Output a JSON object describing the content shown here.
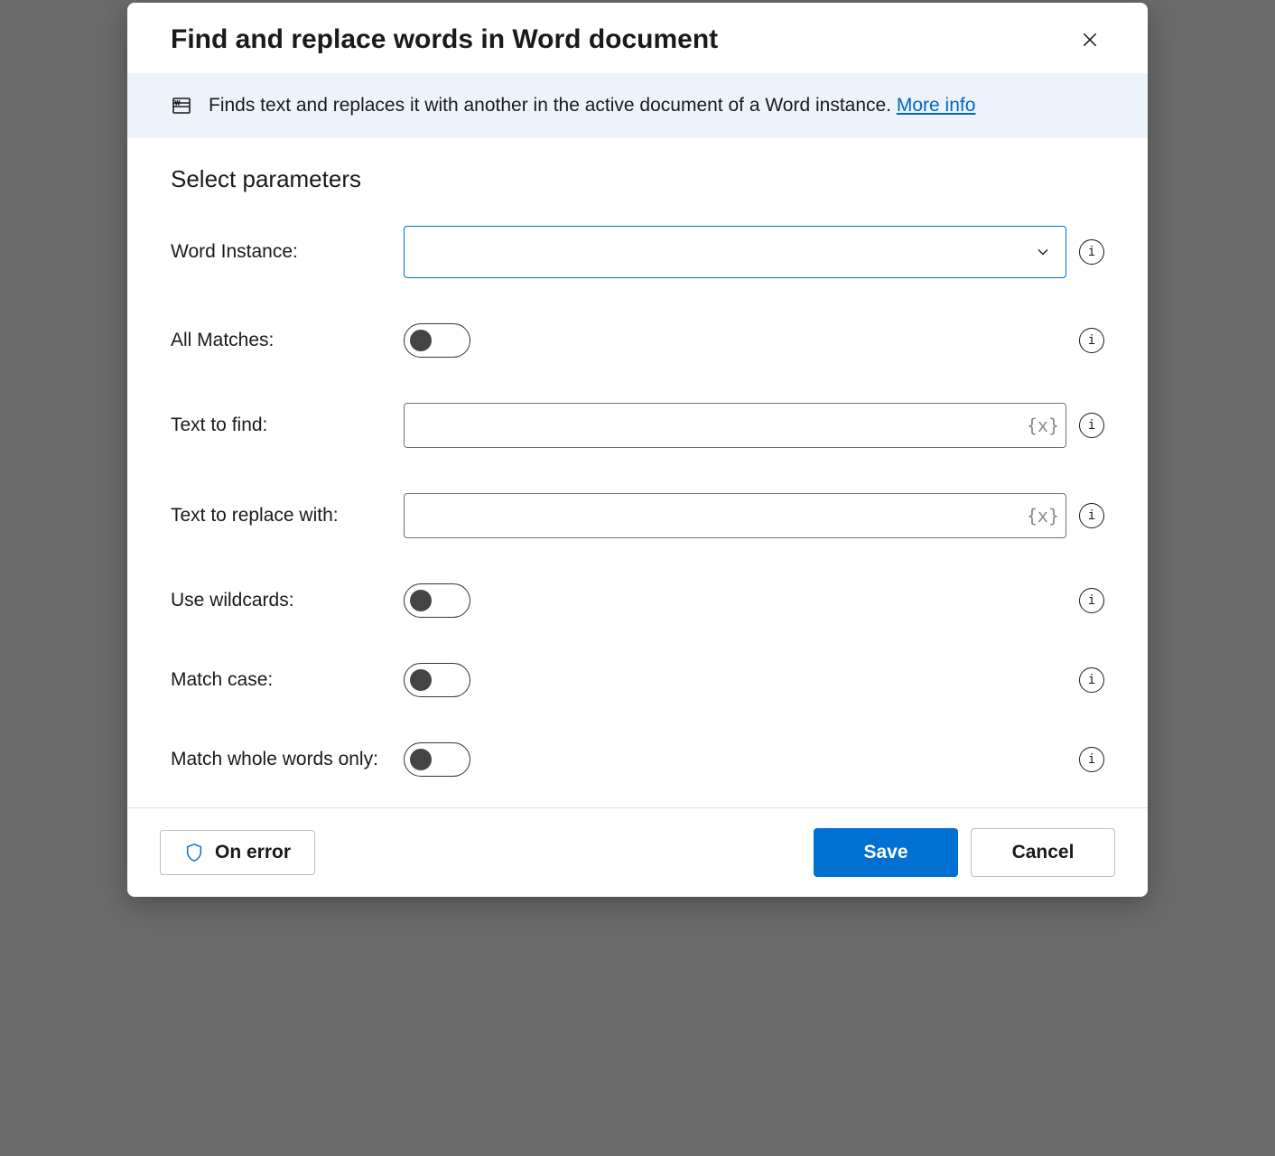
{
  "dialog": {
    "title": "Find and replace words in Word document",
    "banner_text": "Finds text and replaces it with another in the active document of a Word instance. ",
    "more_info": "More info",
    "section_title": "Select parameters"
  },
  "fields": {
    "word_instance": {
      "label": "Word Instance:",
      "value": ""
    },
    "all_matches": {
      "label": "All Matches:",
      "value": false
    },
    "text_find": {
      "label": "Text to find:",
      "value": ""
    },
    "text_replace": {
      "label": "Text to replace with:",
      "value": ""
    },
    "use_wildcards": {
      "label": "Use wildcards:",
      "value": false
    },
    "match_case": {
      "label": "Match case:",
      "value": false
    },
    "match_whole": {
      "label": "Match whole words only:",
      "value": false
    }
  },
  "footer": {
    "on_error": "On error",
    "save": "Save",
    "cancel": "Cancel"
  }
}
